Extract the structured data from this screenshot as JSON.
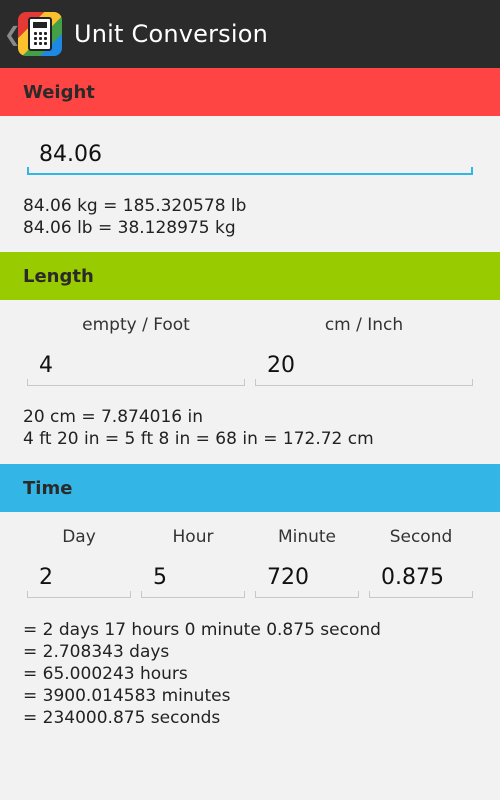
{
  "actionbar": {
    "back_glyph": "❮",
    "icon": "calculator-icon",
    "title": "Unit Conversion"
  },
  "weight": {
    "header": "Weight",
    "input_value": "84.06",
    "results": [
      "84.06 kg = 185.320578 lb",
      "84.06 lb = 38.128975 kg"
    ]
  },
  "length": {
    "header": "Length",
    "col1_label": "empty / Foot",
    "col2_label": "cm / Inch",
    "col1_value": "4",
    "col2_value": "20",
    "results": [
      "20 cm = 7.874016 in",
      "4 ft 20 in = 5 ft 8 in = 68 in = 172.72 cm"
    ]
  },
  "time": {
    "header": "Time",
    "labels": [
      "Day",
      "Hour",
      "Minute",
      "Second"
    ],
    "values": [
      "2",
      "5",
      "720",
      "0.875"
    ],
    "results": [
      "= 2 days 17 hours 0 minute 0.875 second",
      "= 2.708343 days",
      "= 65.000243 hours",
      "= 3900.014583 minutes",
      "= 234000.875 seconds"
    ]
  },
  "colors": {
    "weight": "#ff4444",
    "length": "#99cc00",
    "time": "#33b5e5",
    "actionbar": "#2b2b2b"
  }
}
